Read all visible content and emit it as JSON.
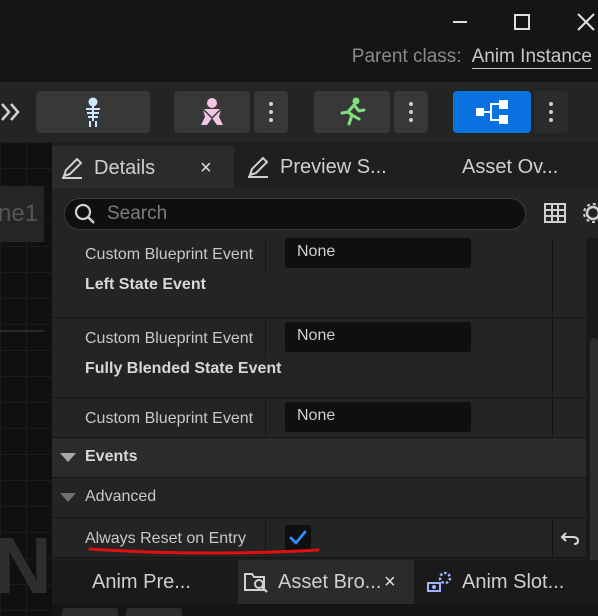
{
  "window": {
    "parent_class_label": "Parent class:",
    "parent_class_value": "Anim Instance"
  },
  "toolbar": {
    "buttons": [
      "skeleton-icon",
      "mesh-icon",
      "animation-icon",
      "blueprint-graph-icon"
    ],
    "active": "blueprint-graph-icon"
  },
  "graph": {
    "tab_fragment": "ne1",
    "big_fragment": "N"
  },
  "details": {
    "tabs": [
      {
        "label": "Details",
        "active": true
      },
      {
        "label": "Preview S..."
      },
      {
        "label": "Asset Ov..."
      }
    ],
    "close_glyph": "×",
    "search_placeholder": "Search",
    "rows": [
      {
        "name": "Custom Blueprint Event",
        "value": "None",
        "sub": "Left State Event"
      },
      {
        "name": "Custom Blueprint Event",
        "value": "None",
        "sub": "Fully Blended State Event"
      },
      {
        "name": "Custom Blueprint Event",
        "value": "None"
      }
    ],
    "category_events": "Events",
    "category_advanced": "Advanced",
    "always_reset": {
      "label": "Always Reset on Entry",
      "checked": true
    }
  },
  "bottom_tabs": [
    {
      "label": "Anim Pre..."
    },
    {
      "label": "Asset Bro...",
      "active": true
    },
    {
      "label": "Anim Slot..."
    }
  ],
  "colors": {
    "accent": "#0a72e0",
    "annotation": "#e01010",
    "check": "#2f8cff"
  }
}
